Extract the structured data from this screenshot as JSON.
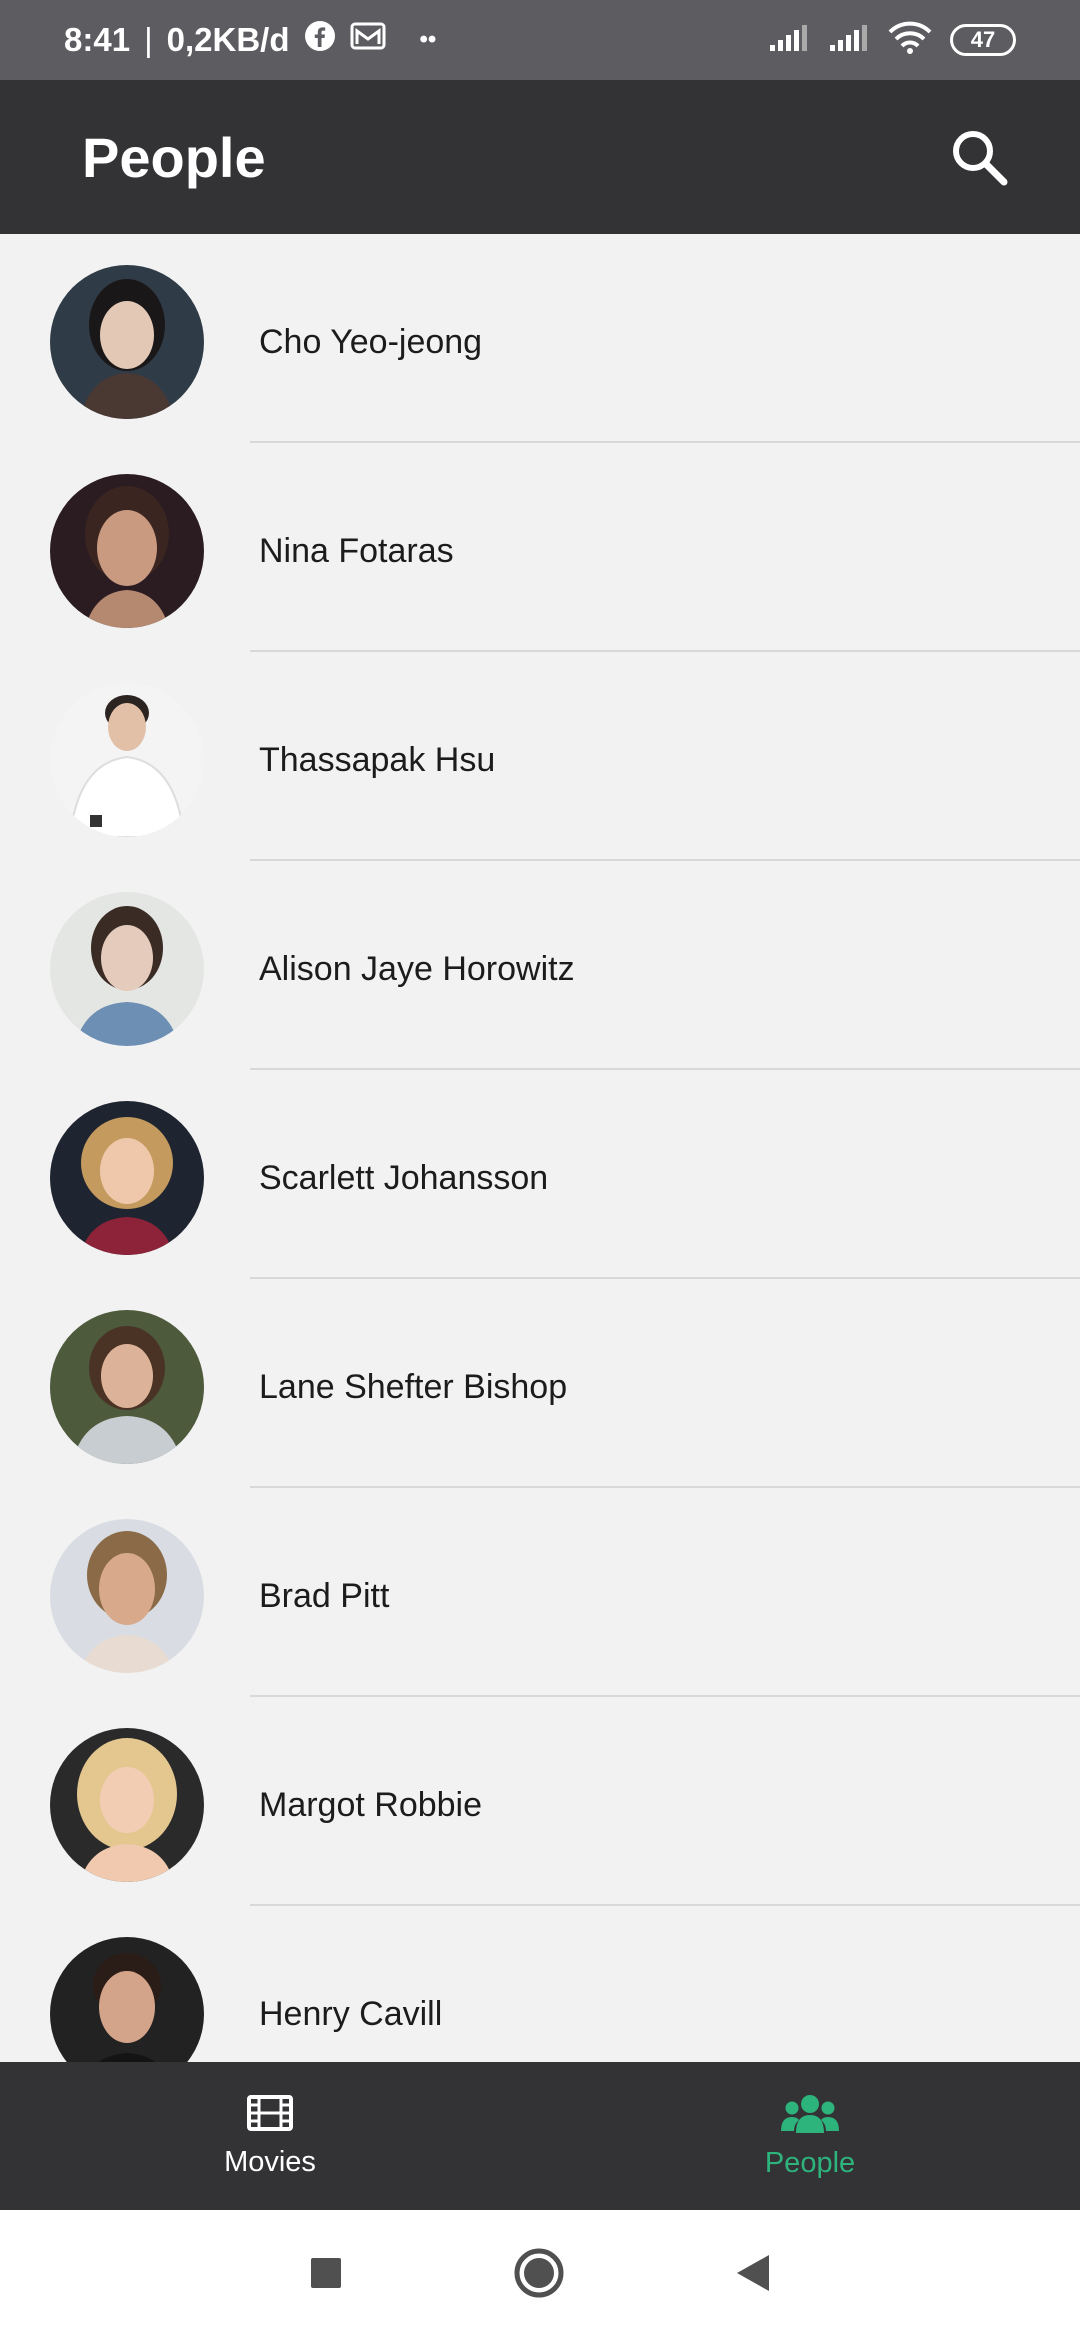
{
  "status_bar": {
    "time": "8:41",
    "network_speed": "0,2KB/d",
    "notif_icons": [
      "facebook-icon",
      "mail-icon"
    ],
    "more_dots": "••",
    "battery": "47"
  },
  "app_bar": {
    "title": "People",
    "search_icon": "search-icon"
  },
  "people": [
    {
      "name": "Cho Yeo-jeong"
    },
    {
      "name": "Nina Fotaras"
    },
    {
      "name": "Thassapak Hsu"
    },
    {
      "name": "Alison Jaye Horowitz"
    },
    {
      "name": "Scarlett Johansson"
    },
    {
      "name": "Lane Shefter Bishop"
    },
    {
      "name": "Brad Pitt"
    },
    {
      "name": "Margot Robbie"
    },
    {
      "name": "Henry Cavill"
    }
  ],
  "bottom_nav": {
    "items": [
      {
        "label": "Movies",
        "icon": "film-icon",
        "active": false
      },
      {
        "label": "People",
        "icon": "people-icon",
        "active": true
      }
    ]
  },
  "colors": {
    "app_bar": "#333235",
    "status_bar": "#5d5c61",
    "accent": "#2db37c",
    "list_bg": "#f2f2f2"
  },
  "system_nav": {
    "icons": [
      "recents-square-icon",
      "home-circle-icon",
      "back-triangle-icon"
    ]
  }
}
